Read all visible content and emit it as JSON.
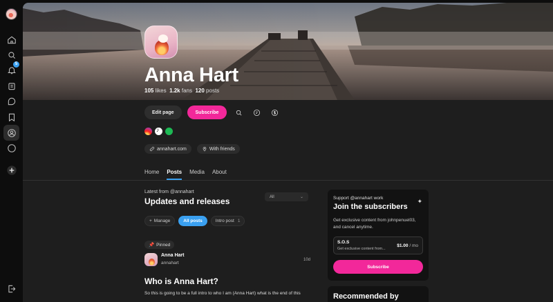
{
  "sidebar": {
    "notifications_badge": "5",
    "icons": [
      "home-icon",
      "search-icon",
      "bell-icon",
      "collections-icon",
      "chat-icon",
      "bookmark-icon",
      "profile-icon",
      "more-icon",
      "plus-icon",
      "logout-icon"
    ]
  },
  "profile": {
    "name": "Anna Hart",
    "likes_count": "105",
    "likes_label": "likes",
    "fans_count": "1.2k",
    "fans_label": "fans",
    "posts_count": "120",
    "posts_label": "posts"
  },
  "actions": {
    "edit_label": "Edit page",
    "subscribe_label": "Subscribe"
  },
  "links": {
    "website": "annahart.com",
    "location": "With friends"
  },
  "tabs": [
    {
      "label": "Home"
    },
    {
      "label": "Posts"
    },
    {
      "label": "Media"
    },
    {
      "label": "About"
    }
  ],
  "feed": {
    "kicker": "Latest from @annahart",
    "title": "Updates and releases",
    "filter_value": "All",
    "manage_label": "Manage",
    "all_posts_label": "All posts",
    "intro_label": "Intro post",
    "intro_count": "1"
  },
  "post": {
    "pinned_label": "Pinned",
    "author": "Anna Hart",
    "handle": "annahart",
    "time": "10d",
    "title": "Who is Anna Hart?",
    "excerpt": "So this is going to be a full intro to who I am (Anna Hart) what is the end of this"
  },
  "support": {
    "kicker": "Support @annahart work",
    "title": "Join the subscribers",
    "description": "Get exclusive content from johnpenuel03, and cancel anytime.",
    "tier_name": "S.O.S",
    "tier_desc": "Get exclusive content from...",
    "tier_price": "$1.00",
    "tier_period": "/ mo",
    "button_label": "Subscribe"
  },
  "recommended": {
    "title": "Recommended by"
  },
  "colors": {
    "accent_pink": "#f2289a",
    "accent_blue": "#3aa0f0",
    "panel": "#1e1e1e"
  }
}
